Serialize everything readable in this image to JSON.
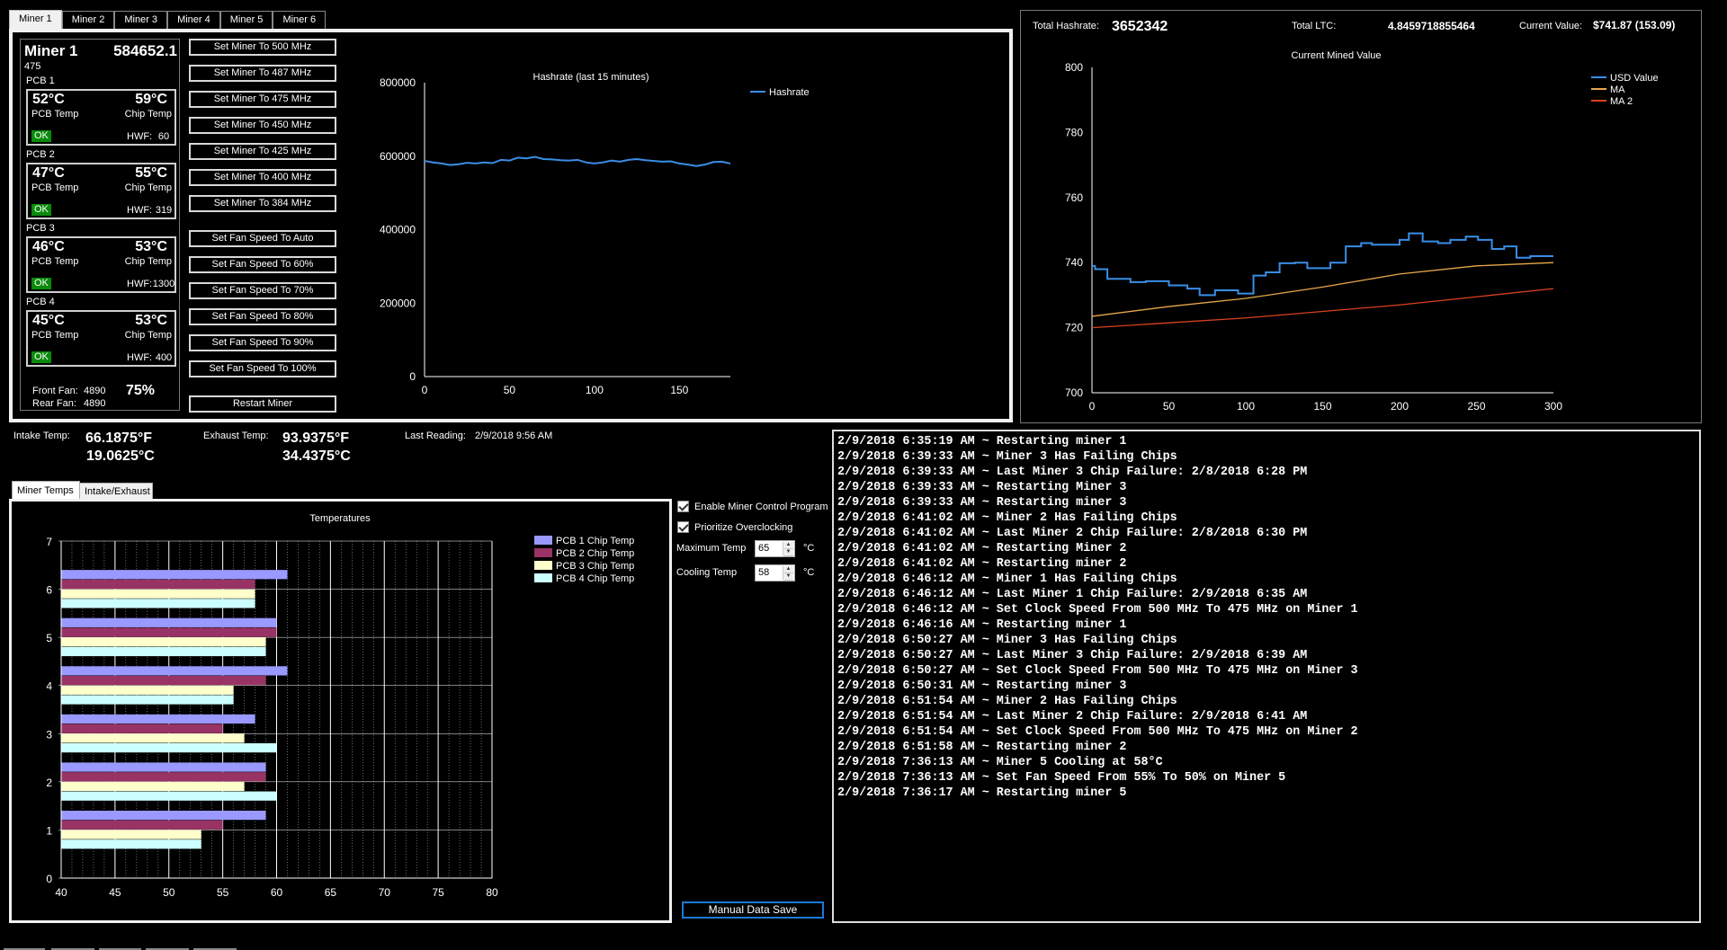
{
  "miner_tabs": [
    "Miner 1",
    "Miner 2",
    "Miner 3",
    "Miner 4",
    "Miner 5",
    "Miner 6"
  ],
  "active_miner_tab": 0,
  "miner": {
    "name": "Miner 1",
    "hashrate": "584652.1",
    "clock": "475",
    "pcbs": [
      {
        "label": "PCB 1",
        "pcb_temp": "52°C",
        "chip_temp": "59°C",
        "pcb_temp_label": "PCB Temp",
        "chip_temp_label": "Chip Temp",
        "status": "OK",
        "hwf_label": "HWF:",
        "hwf": "60"
      },
      {
        "label": "PCB 2",
        "pcb_temp": "47°C",
        "chip_temp": "55°C",
        "pcb_temp_label": "PCB Temp",
        "chip_temp_label": "Chip Temp",
        "status": "OK",
        "hwf_label": "HWF:",
        "hwf": "319"
      },
      {
        "label": "PCB 3",
        "pcb_temp": "46°C",
        "chip_temp": "53°C",
        "pcb_temp_label": "PCB Temp",
        "chip_temp_label": "Chip Temp",
        "status": "OK",
        "hwf_label": "HWF:",
        "hwf": "1300"
      },
      {
        "label": "PCB 4",
        "pcb_temp": "45°C",
        "chip_temp": "53°C",
        "pcb_temp_label": "PCB Temp",
        "chip_temp_label": "Chip Temp",
        "status": "OK",
        "hwf_label": "HWF:",
        "hwf": "400"
      }
    ],
    "front_fan_label": "Front Fan:",
    "front_fan": "4890",
    "rear_fan_label": "Rear Fan:",
    "rear_fan": "4890",
    "fan_percent": "75%"
  },
  "commands": {
    "clock": [
      "Set Miner To 500 MHz",
      "Set Miner To 487 MHz",
      "Set Miner To 475 MHz",
      "Set Miner To 450 MHz",
      "Set Miner To 425 MHz",
      "Set Miner To 400 MHz",
      "Set Miner To 384 MHz"
    ],
    "fan": [
      "Set Fan Speed To Auto",
      "Set Fan Speed To 60%",
      "Set Fan Speed To 70%",
      "Set Fan Speed To 80%",
      "Set Fan Speed To 90%",
      "Set Fan Speed To 100%"
    ],
    "restart": "Restart Miner"
  },
  "summary": {
    "total_hashrate_label": "Total Hashrate:",
    "total_hashrate": "3652342",
    "total_ltc_label": "Total LTC:",
    "total_ltc": "4.8459718855464",
    "current_value_label": "Current Value:",
    "current_value": "$741.87 (153.09)"
  },
  "environment": {
    "intake_label": "Intake Temp:",
    "intake_f": "66.1875°F",
    "intake_c": "19.0625°C",
    "exhaust_label": "Exhaust Temp:",
    "exhaust_f": "93.9375°F",
    "exhaust_c": "34.4375°C",
    "last_reading_label": "Last Reading:",
    "last_reading": "2/9/2018 9:56 AM"
  },
  "temp_tabs": [
    "Miner Temps",
    "Intake/Exhaust"
  ],
  "control": {
    "enable_label": "Enable Miner Control Program",
    "enable_checked": true,
    "prioritize_label": "Prioritize Overclocking",
    "prioritize_checked": true,
    "max_temp_label": "Maximum Temp",
    "max_temp": "65",
    "cooling_temp_label": "Cooling Temp",
    "cooling_temp": "58",
    "unit": "°C",
    "manual_save": "Manual Data Save"
  },
  "log": [
    "2/9/2018 6:35:19 AM ~ Restarting miner 1",
    "2/9/2018 6:39:33 AM ~ Miner 3 Has Failing Chips",
    "2/9/2018 6:39:33 AM ~ Last Miner 3 Chip Failure: 2/8/2018 6:28 PM",
    "2/9/2018 6:39:33 AM ~ Restarting Miner 3",
    "2/9/2018 6:39:33 AM ~ Restarting miner 3",
    "2/9/2018 6:41:02 AM ~ Miner 2 Has Failing Chips",
    "2/9/2018 6:41:02 AM ~ Last Miner 2 Chip Failure: 2/8/2018 6:30 PM",
    "2/9/2018 6:41:02 AM ~ Restarting Miner 2",
    "2/9/2018 6:41:02 AM ~ Restarting miner 2",
    "2/9/2018 6:46:12 AM ~ Miner 1 Has Failing Chips",
    "2/9/2018 6:46:12 AM ~ Last Miner 1 Chip Failure: 2/9/2018 6:35 AM",
    "2/9/2018 6:46:12 AM ~ Set Clock Speed From 500 MHz To 475 MHz on Miner 1",
    "2/9/2018 6:46:16 AM ~ Restarting miner 1",
    "2/9/2018 6:50:27 AM ~ Miner 3 Has Failing Chips",
    "2/9/2018 6:50:27 AM ~ Last Miner 3 Chip Failure: 2/9/2018 6:39 AM",
    "2/9/2018 6:50:27 AM ~ Set Clock Speed From 500 MHz To 475 MHz on Miner 3",
    "2/9/2018 6:50:31 AM ~ Restarting miner 3",
    "2/9/2018 6:51:54 AM ~ Miner 2 Has Failing Chips",
    "2/9/2018 6:51:54 AM ~ Last Miner 2 Chip Failure: 2/9/2018 6:41 AM",
    "2/9/2018 6:51:54 AM ~ Set Clock Speed From 500 MHz To 475 MHz on Miner 2",
    "2/9/2018 6:51:58 AM ~ Restarting miner 2",
    "2/9/2018 7:36:13 AM ~ Miner 5 Cooling at 58°C",
    "2/9/2018 7:36:13 AM ~ Set Fan Speed From 55% To 50% on Miner 5",
    "2/9/2018 7:36:17 AM ~ Restarting miner 5"
  ],
  "chart_data": [
    {
      "id": "hashrate",
      "type": "line",
      "title": "Hashrate (last 15 minutes)",
      "xlabel": "",
      "ylabel": "",
      "xlim": [
        0,
        180
      ],
      "ylim": [
        0,
        800000
      ],
      "xticks": [
        0,
        50,
        100,
        150
      ],
      "yticks": [
        0,
        200000,
        400000,
        600000,
        800000
      ],
      "grid": false,
      "legend": "top-right",
      "series": [
        {
          "name": "Hashrate",
          "color": "#3a8ee6",
          "x": [
            0,
            5,
            10,
            15,
            20,
            25,
            30,
            35,
            40,
            45,
            50,
            55,
            60,
            65,
            70,
            75,
            80,
            85,
            90,
            95,
            100,
            105,
            110,
            115,
            120,
            125,
            130,
            135,
            140,
            145,
            150,
            155,
            160,
            165,
            170,
            175,
            180
          ],
          "values": [
            587000,
            583000,
            580000,
            576000,
            578000,
            582000,
            580000,
            583000,
            581000,
            590000,
            588000,
            596000,
            594000,
            598000,
            592000,
            591000,
            589000,
            588000,
            590000,
            583000,
            580000,
            583000,
            588000,
            585000,
            590000,
            592000,
            589000,
            587000,
            585000,
            586000,
            580000,
            577000,
            573000,
            577000,
            584000,
            585000,
            580000
          ]
        }
      ]
    },
    {
      "id": "mined_value",
      "type": "line",
      "title": "Current Mined Value",
      "xlabel": "",
      "ylabel": "",
      "xlim": [
        0,
        300
      ],
      "ylim": [
        700,
        800
      ],
      "xticks": [
        0,
        50,
        100,
        150,
        200,
        250,
        300
      ],
      "yticks": [
        700,
        720,
        740,
        760,
        780,
        800
      ],
      "grid": false,
      "legend": "top-right",
      "series": [
        {
          "name": "USD Value",
          "color": "#3a8ee6",
          "step": true,
          "x": [
            0,
            2,
            10,
            25,
            35,
            50,
            62,
            70,
            80,
            95,
            105,
            113,
            122,
            132,
            140,
            155,
            165,
            175,
            182,
            200,
            206,
            215,
            225,
            233,
            243,
            251,
            260,
            268,
            276,
            285,
            300
          ],
          "values": [
            739,
            738,
            735,
            734,
            734.3,
            733,
            732,
            730,
            731.5,
            730.5,
            736,
            737,
            739.8,
            740,
            738.3,
            740,
            745,
            746,
            745.5,
            747,
            749,
            746.5,
            746,
            747,
            748,
            747,
            744.2,
            745,
            741.5,
            742,
            742
          ]
        },
        {
          "name": "MA",
          "color": "#e8a84a",
          "x": [
            0,
            50,
            100,
            150,
            200,
            250,
            300
          ],
          "values": [
            723.5,
            726.5,
            729,
            732.5,
            736.5,
            739,
            740
          ]
        },
        {
          "name": "MA 2",
          "color": "#d9421e",
          "x": [
            0,
            50,
            100,
            150,
            200,
            250,
            300
          ],
          "values": [
            720,
            721.5,
            723,
            725,
            727,
            729.5,
            732
          ]
        }
      ]
    },
    {
      "id": "temperatures",
      "type": "bar",
      "orientation": "horizontal",
      "title": "Temperatures",
      "xlabel": "",
      "ylabel": "",
      "categories": [
        1,
        2,
        3,
        4,
        5,
        6
      ],
      "xlim": [
        40,
        80
      ],
      "ylim": [
        0,
        7
      ],
      "xticks": [
        40,
        45,
        50,
        55,
        60,
        65,
        70,
        75,
        80
      ],
      "yticks": [
        0,
        1,
        2,
        3,
        4,
        5,
        6,
        7
      ],
      "grid": true,
      "legend": "top-right",
      "series": [
        {
          "name": "PCB 1 Chip Temp",
          "color": "#9999ff",
          "values": [
            59,
            59,
            58,
            61,
            60,
            61
          ]
        },
        {
          "name": "PCB 2 Chip Temp",
          "color": "#993366",
          "values": [
            55,
            59,
            55,
            59,
            60,
            58
          ]
        },
        {
          "name": "PCB 3 Chip Temp",
          "color": "#ffffcc",
          "values": [
            53,
            57,
            57,
            56,
            59,
            58
          ]
        },
        {
          "name": "PCB 4 Chip Temp",
          "color": "#ccffff",
          "values": [
            53,
            60,
            60,
            56,
            59,
            58
          ]
        }
      ]
    }
  ]
}
